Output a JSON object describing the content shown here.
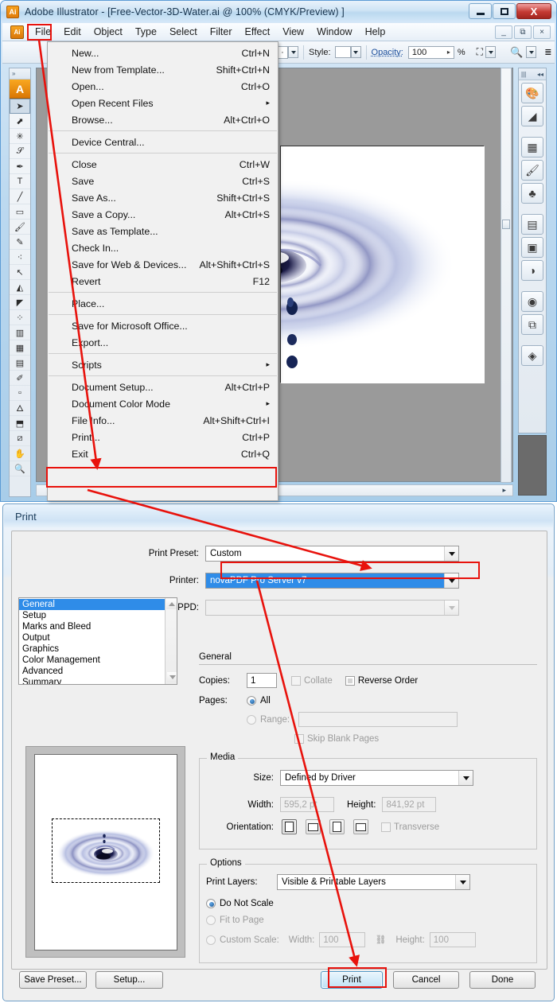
{
  "app": {
    "title": "Adobe Illustrator - [Free-Vector-3D-Water.ai @ 100% (CMYK/Preview) ]",
    "logo_text": "Ai",
    "window_buttons": {
      "minimize": "—",
      "maximize": "□",
      "close": "X"
    },
    "doc_buttons": {
      "minimize": "_",
      "restore": "⧉",
      "close": "×"
    }
  },
  "menubar": {
    "items": [
      {
        "label": "File"
      },
      {
        "label": "Edit"
      },
      {
        "label": "Object"
      },
      {
        "label": "Type"
      },
      {
        "label": "Select"
      },
      {
        "label": "Filter"
      },
      {
        "label": "Effect"
      },
      {
        "label": "View"
      },
      {
        "label": "Window"
      },
      {
        "label": "Help"
      }
    ]
  },
  "controlbar": {
    "style_label": "Style:",
    "opacity_label": "Opacity:",
    "opacity_value": "100",
    "percent_sign": "%"
  },
  "file_menu": {
    "groups": [
      [
        {
          "label": "New...",
          "shortcut": "Ctrl+N"
        },
        {
          "label": "New from Template...",
          "shortcut": "Shift+Ctrl+N"
        },
        {
          "label": "Open...",
          "shortcut": "Ctrl+O"
        },
        {
          "label": "Open Recent Files",
          "shortcut": "",
          "submenu": true
        },
        {
          "label": "Browse...",
          "shortcut": "Alt+Ctrl+O"
        }
      ],
      [
        {
          "label": "Device Central...",
          "shortcut": ""
        }
      ],
      [
        {
          "label": "Close",
          "shortcut": "Ctrl+W"
        },
        {
          "label": "Save",
          "shortcut": "Ctrl+S"
        },
        {
          "label": "Save As...",
          "shortcut": "Shift+Ctrl+S"
        },
        {
          "label": "Save a Copy...",
          "shortcut": "Alt+Ctrl+S"
        },
        {
          "label": "Save as Template...",
          "shortcut": ""
        },
        {
          "label": "Check In...",
          "shortcut": ""
        },
        {
          "label": "Save for Web & Devices...",
          "shortcut": "Alt+Shift+Ctrl+S"
        },
        {
          "label": "Revert",
          "shortcut": "F12"
        }
      ],
      [
        {
          "label": "Place...",
          "shortcut": ""
        }
      ],
      [
        {
          "label": "Save for Microsoft Office...",
          "shortcut": ""
        },
        {
          "label": "Export...",
          "shortcut": ""
        }
      ],
      [
        {
          "label": "Scripts",
          "shortcut": "",
          "submenu": true
        }
      ],
      [
        {
          "label": "Document Setup...",
          "shortcut": "Alt+Ctrl+P"
        },
        {
          "label": "Document Color Mode",
          "shortcut": "",
          "submenu": true
        },
        {
          "label": "File Info...",
          "shortcut": "Alt+Shift+Ctrl+I"
        },
        {
          "label": "Print...",
          "shortcut": "Ctrl+P",
          "highlighted": true
        },
        {
          "label": "Exit",
          "shortcut": "Ctrl+Q"
        }
      ]
    ]
  },
  "print_dialog": {
    "title": "Print",
    "print_preset_label": "Print Preset:",
    "print_preset_value": "Custom",
    "printer_label": "Printer:",
    "printer_value": "novaPDF Pro Server v7",
    "ppd_label": "PPD:",
    "ppd_value": "",
    "categories": [
      "General",
      "Setup",
      "Marks and Bleed",
      "Output",
      "Graphics",
      "Color Management",
      "Advanced",
      "Summary"
    ],
    "selected_category": "General",
    "general": {
      "section_title": "General",
      "copies_label": "Copies:",
      "copies_value": "1",
      "collate_label": "Collate",
      "reverse_order_label": "Reverse Order",
      "pages_label": "Pages:",
      "all_label": "All",
      "range_label": "Range:",
      "range_value": "",
      "skip_blank_label": "Skip Blank Pages"
    },
    "media": {
      "section_title": "Media",
      "size_label": "Size:",
      "size_value": "Defined by Driver",
      "width_label": "Width:",
      "width_value": "595,2 pt",
      "height_label": "Height:",
      "height_value": "841,92 pt",
      "orientation_label": "Orientation:",
      "transverse_label": "Transverse"
    },
    "options": {
      "section_title": "Options",
      "print_layers_label": "Print Layers:",
      "print_layers_value": "Visible & Printable Layers",
      "do_not_scale_label": "Do Not Scale",
      "fit_to_page_label": "Fit to Page",
      "custom_scale_label": "Custom Scale:",
      "custom_width_label": "Width:",
      "custom_width_value": "100",
      "custom_height_label": "Height:",
      "custom_height_value": "100"
    },
    "buttons": {
      "save_preset": "Save Preset...",
      "setup": "Setup...",
      "print": "Print",
      "cancel": "Cancel",
      "done": "Done"
    }
  },
  "colors": {
    "highlight_red": "#e8120c",
    "selection_blue": "#2f8ce8",
    "accent_orange": "#f8a521"
  }
}
